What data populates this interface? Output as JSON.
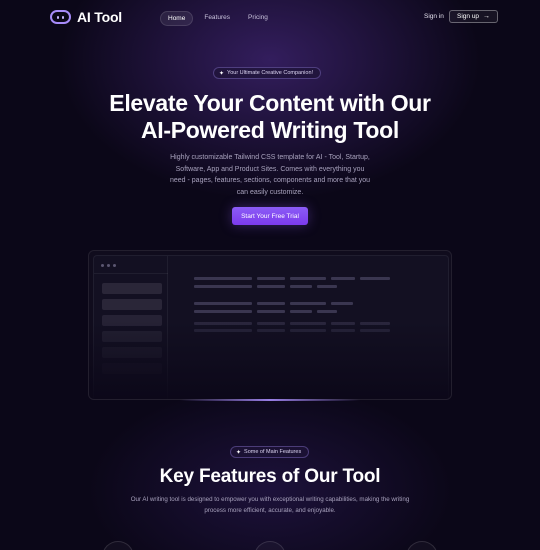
{
  "header": {
    "logo_text": "AI Tool",
    "nav": [
      {
        "label": "Home",
        "active": true
      },
      {
        "label": "Features",
        "active": false
      },
      {
        "label": "Pricing",
        "active": false
      }
    ],
    "signin_label": "Sign in",
    "signup_label": "Sign up"
  },
  "hero": {
    "badge": "Your Ultimate Creative Companion!",
    "title_line1": "Elevate Your Content with Our",
    "title_line2": "AI-Powered Writing Tool",
    "description": "Highly customizable Tailwind CSS template for AI - Tool, Startup, Software, App and Product Sites. Comes with everything you need - pages, features, sections, components and more that you can easily customize.",
    "cta_label": "Start Your Free Trial"
  },
  "features": {
    "badge": "Some of Main Features",
    "title": "Key Features of Our Tool",
    "description": "Our AI writing tool is designed to empower you with exceptional writing capabilities, making the writing process more efficient, accurate, and enjoyable."
  },
  "colors": {
    "background": "#0b0718",
    "accent": "#8b5cf6",
    "logo_outline": "#a78bfa"
  },
  "icons": {
    "logo": "robot-face-icon",
    "sparkle": "sparkle-icon",
    "arrow": "arrow-right-icon"
  }
}
